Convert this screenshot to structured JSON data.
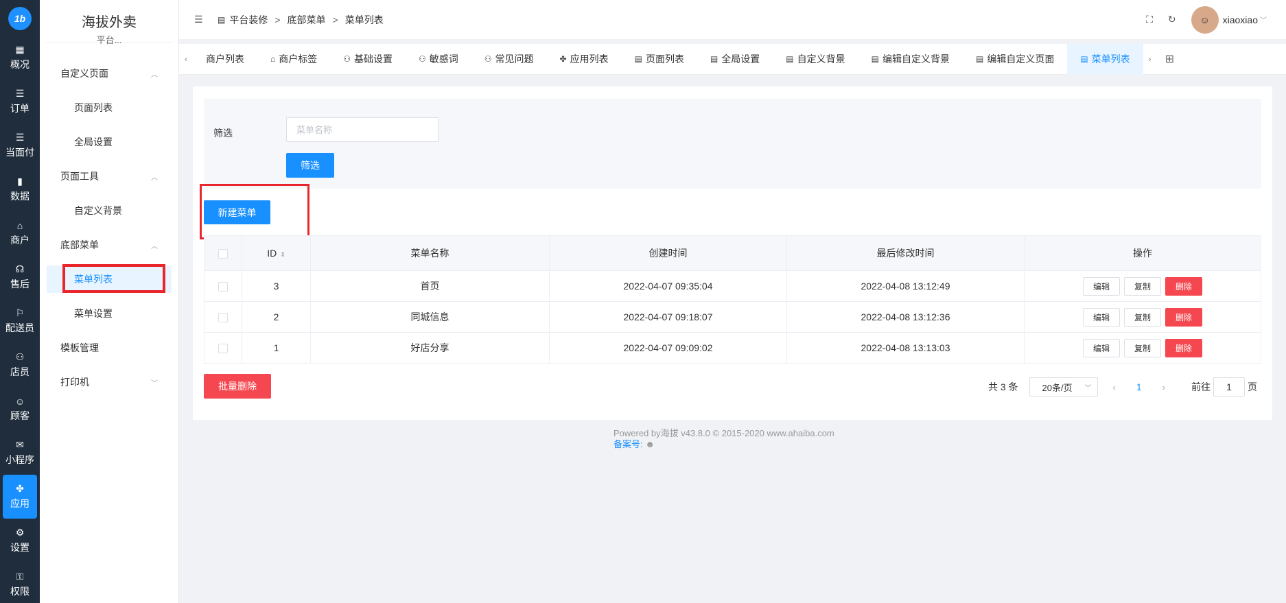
{
  "rail": {
    "logo": "1b",
    "items": [
      {
        "label": "概况",
        "icon": "dashboard-icon",
        "glyph": "▦"
      },
      {
        "label": "订单",
        "icon": "list-icon",
        "glyph": "☰"
      },
      {
        "label": "当面付",
        "icon": "list-icon",
        "glyph": "☰"
      },
      {
        "label": "数据",
        "icon": "bar-chart-icon",
        "glyph": "▮"
      },
      {
        "label": "商户",
        "icon": "store-icon",
        "glyph": "⌂"
      },
      {
        "label": "售后",
        "icon": "headset-icon",
        "glyph": "☊"
      },
      {
        "label": "配送员",
        "icon": "scooter-icon",
        "glyph": "⚐"
      },
      {
        "label": "店员",
        "icon": "users-icon",
        "glyph": "⚇"
      },
      {
        "label": "顾客",
        "icon": "user-circle-icon",
        "glyph": "☺"
      },
      {
        "label": "小程序",
        "icon": "wechat-icon",
        "glyph": "✉"
      },
      {
        "label": "应用",
        "icon": "apps-icon",
        "glyph": "✤",
        "active": true
      },
      {
        "label": "设置",
        "icon": "user-gear-icon",
        "glyph": "⚙"
      },
      {
        "label": "权限",
        "icon": "lock-icon",
        "glyph": "⚿"
      }
    ]
  },
  "submenu": {
    "brand_title": "海拔外卖",
    "brand_sub": "平台...",
    "group1": "自定义页面",
    "item_page_list": "页面列表",
    "item_global": "全局设置",
    "group2": "页面工具",
    "item_custom_bg": "自定义背景",
    "group3": "底部菜单",
    "item_menu_list": "菜单列表",
    "item_menu_settings": "菜单设置",
    "group4": "模板管理",
    "group5": "打印机"
  },
  "header": {
    "crumb1": "平台装修",
    "crumb2": "底部菜单",
    "crumb3": "菜单列表",
    "sep": ">",
    "username": "xiaoxiao"
  },
  "tabs": [
    {
      "label": "商户列表",
      "icon": "none"
    },
    {
      "label": "商户标签",
      "icon": "store-icon",
      "glyph": "⌂"
    },
    {
      "label": "基础设置",
      "icon": "user-gear-icon",
      "glyph": "⚇"
    },
    {
      "label": "敏感词",
      "icon": "user-gear-icon",
      "glyph": "⚇"
    },
    {
      "label": "常见问题",
      "icon": "user-gear-icon",
      "glyph": "⚇"
    },
    {
      "label": "应用列表",
      "icon": "apps-icon",
      "glyph": "✤"
    },
    {
      "label": "页面列表",
      "icon": "server-icon",
      "glyph": "▤"
    },
    {
      "label": "全局设置",
      "icon": "server-icon",
      "glyph": "▤"
    },
    {
      "label": "自定义背景",
      "icon": "server-icon",
      "glyph": "▤"
    },
    {
      "label": "编辑自定义背景",
      "icon": "server-icon",
      "glyph": "▤"
    },
    {
      "label": "编辑自定义页面",
      "icon": "server-icon",
      "glyph": "▤"
    },
    {
      "label": "菜单列表",
      "icon": "server-icon",
      "glyph": "▤",
      "active": true
    }
  ],
  "filter": {
    "label": "筛选",
    "placeholder": "菜单名称",
    "button": "筛选"
  },
  "new_button": "新建菜单",
  "table": {
    "columns": [
      "ID",
      "菜单名称",
      "创建时间",
      "最后修改时间",
      "操作"
    ],
    "rows": [
      {
        "id": "3",
        "name": "首页",
        "created": "2022-04-07 09:35:04",
        "modified": "2022-04-08 13:12:49"
      },
      {
        "id": "2",
        "name": "同城信息",
        "created": "2022-04-07 09:18:07",
        "modified": "2022-04-08 13:12:36"
      },
      {
        "id": "1",
        "name": "好店分享",
        "created": "2022-04-07 09:09:02",
        "modified": "2022-04-08 13:13:03"
      }
    ],
    "edit_label": "编辑",
    "copy_label": "复制",
    "delete_label": "删除"
  },
  "batch_delete": "批量删除",
  "pager": {
    "total": "共 3 条",
    "size": "20条/页",
    "current": "1",
    "goto_prefix": "前往",
    "goto_value": "1",
    "goto_suffix": "页"
  },
  "footer": {
    "line1": "Powered by海拔 v43.8.0 © 2015-2020 www.ahaiba.com",
    "icp": "备案号:"
  }
}
